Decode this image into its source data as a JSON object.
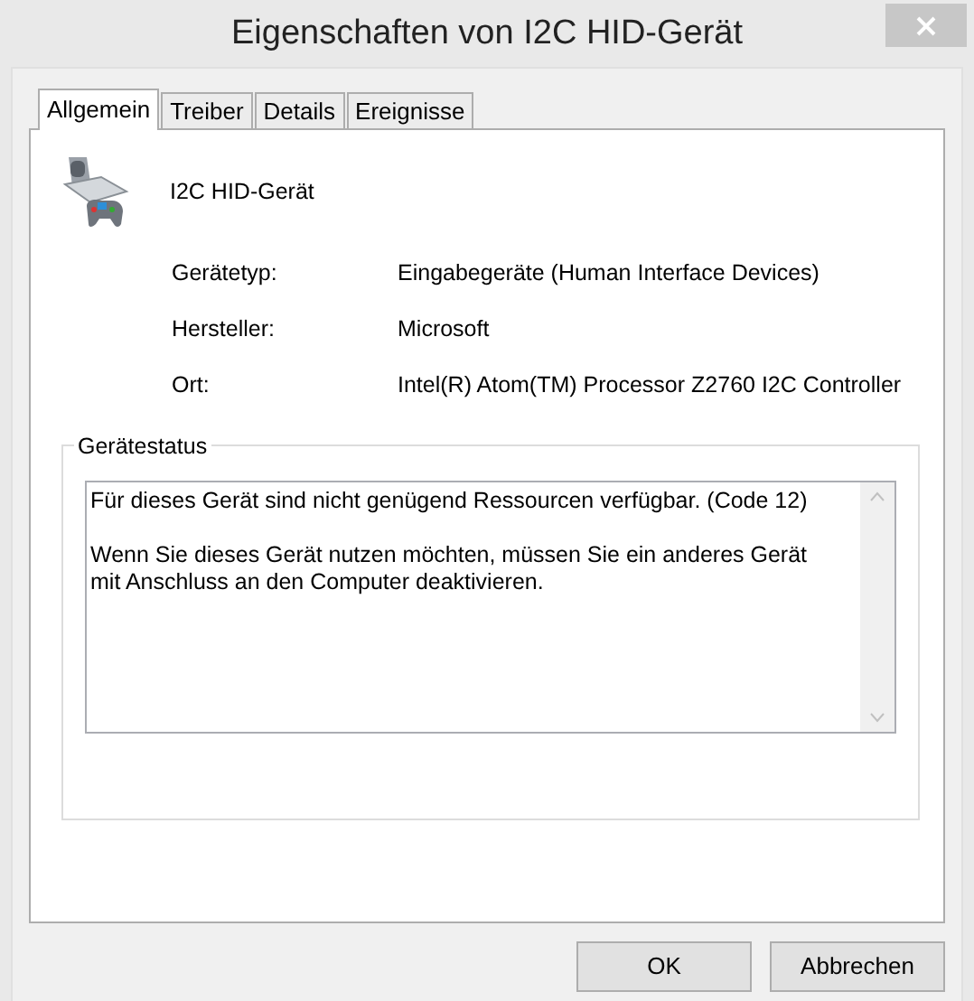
{
  "window": {
    "title": "Eigenschaften von I2C HID-Gerät"
  },
  "tabs": [
    {
      "label": "Allgemein",
      "selected": true
    },
    {
      "label": "Treiber",
      "selected": false
    },
    {
      "label": "Details",
      "selected": false
    },
    {
      "label": "Ereignisse",
      "selected": false
    }
  ],
  "device": {
    "name": "I2C HID-Gerät"
  },
  "properties": [
    {
      "label": "Gerätetyp:",
      "value": "Eingabegeräte (Human Interface Devices)"
    },
    {
      "label": "Hersteller:",
      "value": "Microsoft"
    },
    {
      "label": "Ort:",
      "value": "Intel(R) Atom(TM) Processor Z2760 I2C Controller"
    }
  ],
  "device_status": {
    "title": "Gerätestatus",
    "paragraphs": [
      "Für dieses Gerät sind nicht genügend Ressourcen verfügbar. (Code 12)",
      "Wenn Sie dieses Gerät nutzen möchten, müssen Sie ein anderes Gerät mit Anschluss an den Computer deaktivieren."
    ]
  },
  "buttons": [
    {
      "label": "OK"
    },
    {
      "label": "Abbrechen"
    }
  ]
}
